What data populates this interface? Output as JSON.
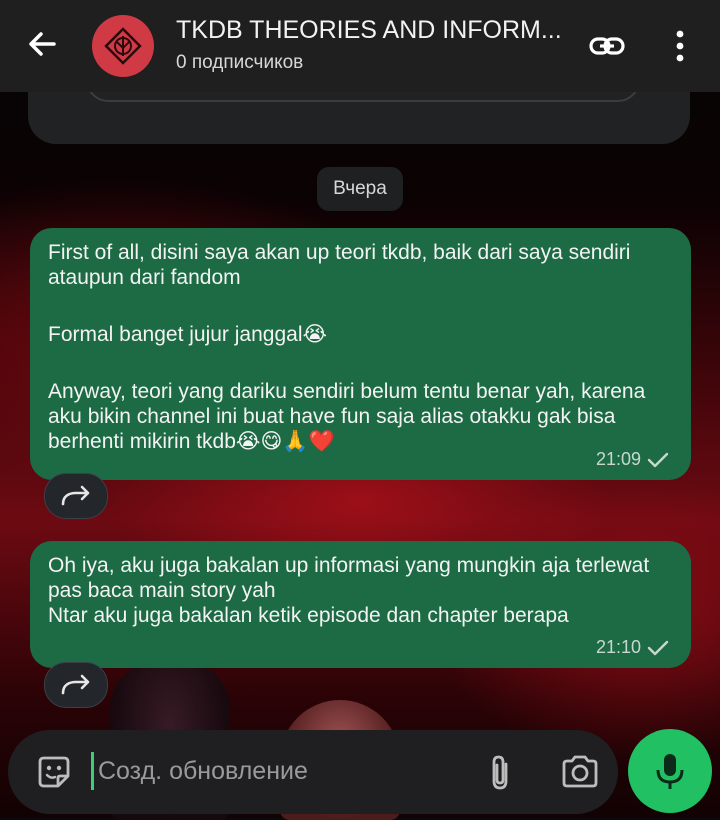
{
  "header": {
    "title": "TKDB THEORIES AND INFORM...",
    "subtitle": "0 подписчиков"
  },
  "date_chip": "Вчера",
  "messages": [
    {
      "paragraphs": [
        "First of all, disini saya akan up teori tkdb, baik dari saya sendiri ataupun dari fandom",
        "Formal banget jujur janggal😭",
        "Anyway, teori yang dariku sendiri belum tentu benar yah, karena aku bikin channel ini buat have fun saja alias otakku gak bisa berhenti mikirin tkdb😭😋🙏❤️"
      ],
      "time": "21:09"
    },
    {
      "paragraphs": [
        "Oh iya, aku juga bakalan up informasi yang mungkin aja terlewat pas baca main story yah\nNtar aku juga bakalan ketik episode dan chapter berapa"
      ],
      "time": "21:10"
    }
  ],
  "composer": {
    "placeholder": "Созд. обновление"
  },
  "colors": {
    "bubble": "#1d6b45",
    "header": "#1f1f1f",
    "mic": "#21c063"
  },
  "icons": [
    "back-arrow-icon",
    "channel-logo",
    "link-icon",
    "more-vertical-icon",
    "forward-icon",
    "sticker-icon",
    "paperclip-icon",
    "camera-icon",
    "microphone-icon",
    "check-icon"
  ]
}
